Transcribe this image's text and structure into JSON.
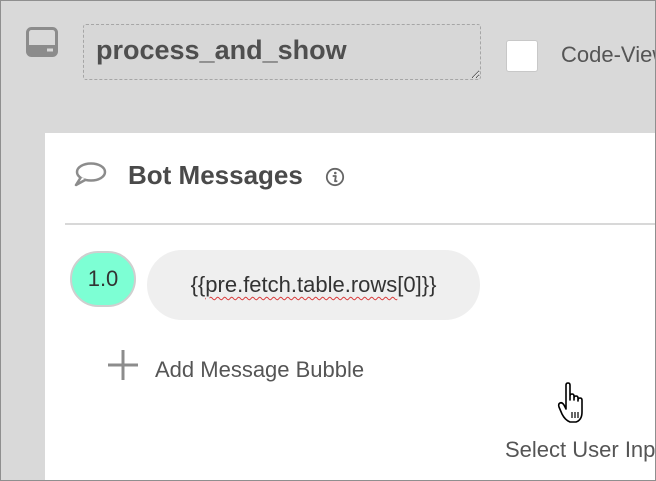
{
  "header": {
    "node_name": "process_and_show",
    "code_view_label": "Code-View",
    "code_view_checked": false
  },
  "bot_messages": {
    "title": "Bot Messages",
    "messages": [
      {
        "version": "1.0",
        "text": "{{pre.fetch.table.rows[0]}}"
      }
    ],
    "add_bubble_label": "Add Message Bubble"
  },
  "user_input": {
    "label": "Select User Input"
  },
  "icons": {
    "node": "monitor-tray-icon",
    "messages": "speech-bubble-icon",
    "info": "info-icon",
    "add": "plus-icon",
    "pointer": "hand-cursor-icon"
  },
  "colors": {
    "background": "#d9d9d9",
    "panel": "#ffffff",
    "version_badge": "#7dffd4",
    "bubble": "#efefef",
    "text": "#4a4a4a"
  }
}
